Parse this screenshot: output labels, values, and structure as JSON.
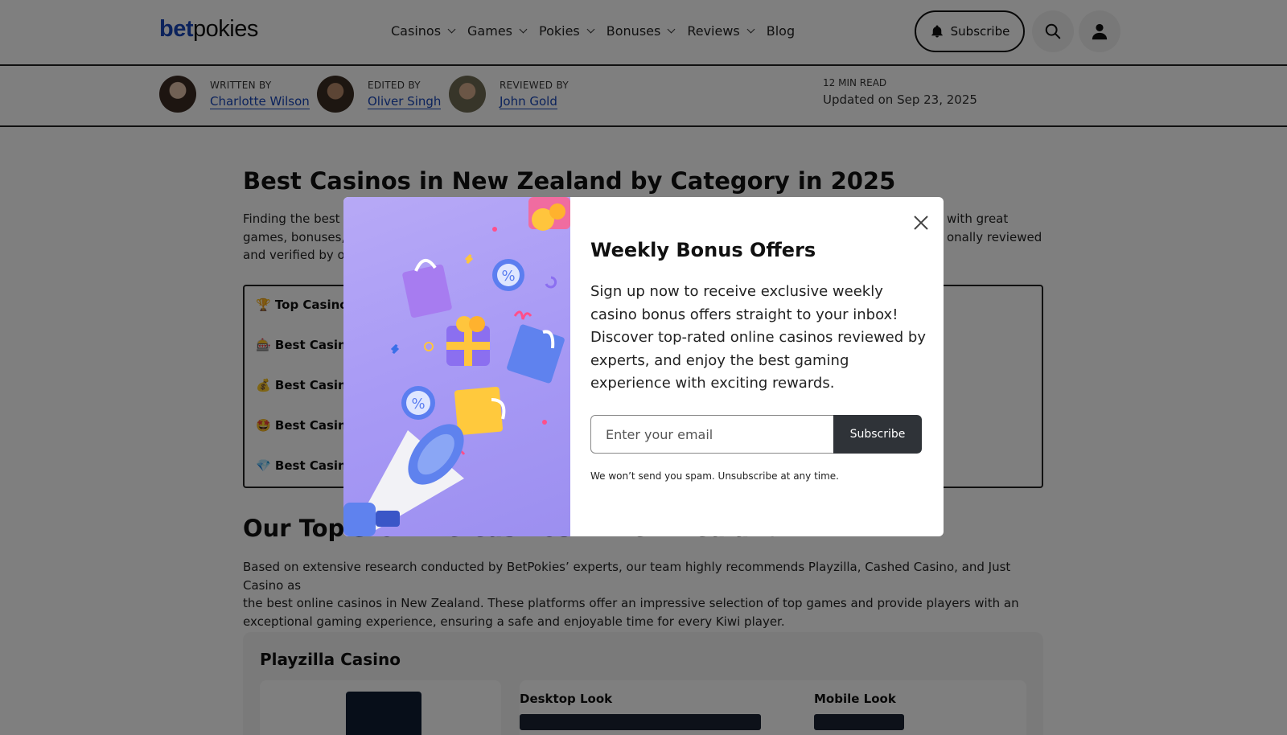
{
  "header": {
    "logo_bet": "bet",
    "logo_pokies": "pokies",
    "nav": [
      {
        "label": "Casinos",
        "dropdown": true
      },
      {
        "label": "Games",
        "dropdown": true
      },
      {
        "label": "Pokies",
        "dropdown": true
      },
      {
        "label": "Bonuses",
        "dropdown": true
      },
      {
        "label": "Reviews",
        "dropdown": true
      },
      {
        "label": "Blog",
        "dropdown": false
      }
    ],
    "subscribe_label": "Subscribe"
  },
  "authors": {
    "written_role": "WRITTEN BY",
    "written_name": "Charlotte Wilson",
    "edited_role": "EDITED BY",
    "edited_name": "Oliver Singh",
    "reviewed_role": "REVIEWED BY",
    "reviewed_name": "John Gold",
    "read_time": "12 MIN READ",
    "updated": "Updated on Sep 23, 2025"
  },
  "article": {
    "title": "Best Casinos in New Zealand by Category in 2025",
    "intro_line1": "Finding the best c",
    "intro_line1_end": "with great",
    "intro_line2": "games, bonuses, a",
    "intro_line2_end": "onally reviewed",
    "intro_line3": "and verified by ou",
    "categories": [
      {
        "icon": "🏆",
        "label": "Top Casino C"
      },
      {
        "icon": "🎰",
        "label": "Best Casino f"
      },
      {
        "icon": "💰",
        "label": "Best Casino f"
      },
      {
        "icon": "🤩",
        "label": "Best Casino f"
      },
      {
        "icon": "💎",
        "label": "Best Casino f"
      }
    ],
    "h2": "Our Top 3 Online Casinos in New Zealand",
    "para2_l1": "Based on extensive research conducted by BetPokies’ experts, our team highly recommends Playzilla, Cashed Casino, and Just Casino as",
    "para2_l2": "the best online casinos in New Zealand. These platforms offer an impressive selection of top games and provide players with an",
    "para2_l3": "exceptional gaming experience, ensuring a safe and enjoyable time for every Kiwi player.",
    "card_title": "Playzilla Casino",
    "desktop_look": "Desktop Look",
    "mobile_look": "Mobile Look"
  },
  "modal": {
    "title": "Weekly Bonus Offers",
    "text": "Sign up now to receive exclusive weekly casino bonus offers straight to your inbox! Discover top-rated online casinos reviewed by experts, and enjoy the best gaming experience with exciting rewards.",
    "email_placeholder": "Enter your email",
    "subscribe_label": "Subscribe",
    "note": "We won’t send you spam. Unsubscribe at any time."
  },
  "colors": {
    "brand_blue": "#1745b8",
    "overlay": "rgba(0,0,0,0.5)",
    "button_dark": "#2f3338",
    "modal_image_bg": "#a89af5"
  }
}
